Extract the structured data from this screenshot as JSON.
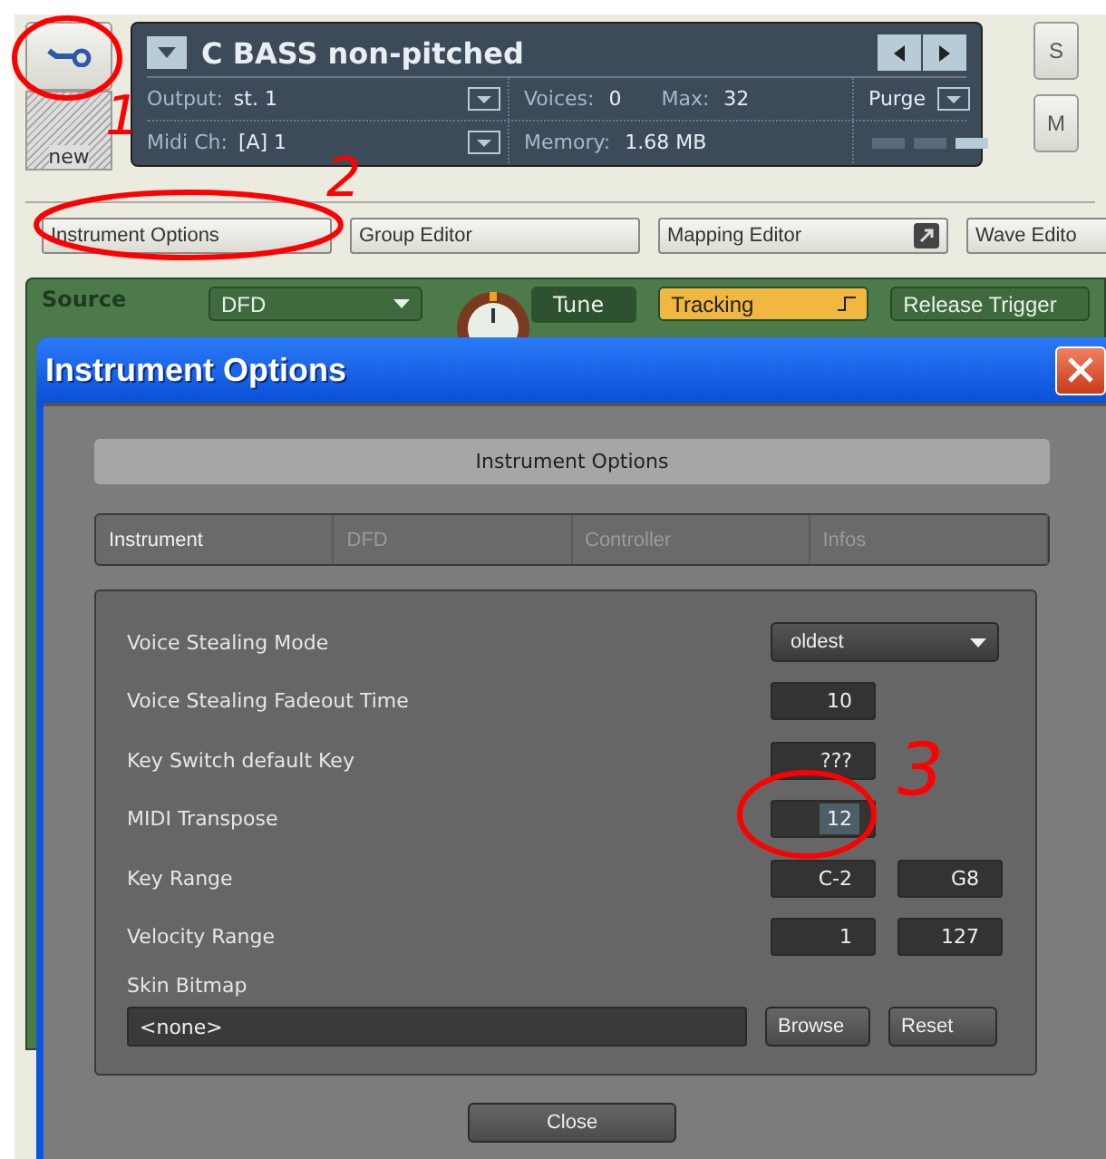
{
  "instrument_header": {
    "new_label": "new",
    "title": "C BASS non-pitched",
    "output_label": "Output:",
    "output_value": "st. 1",
    "midi_label": "Midi Ch:",
    "midi_value": "[A]  1",
    "voices_label": "Voices:",
    "voices_value": "0",
    "max_label": "Max:",
    "max_value": "32",
    "memory_label": "Memory:",
    "memory_value": "1.68 MB",
    "purge_label": "Purge"
  },
  "side_buttons": [
    "S",
    "M"
  ],
  "editor_tabs": [
    {
      "label": "Instrument Options",
      "kind": "plain"
    },
    {
      "label": "Group Editor",
      "kind": "plain"
    },
    {
      "label": "Mapping Editor",
      "kind": "popout"
    },
    {
      "label": "Wave Edito",
      "kind": "plain"
    }
  ],
  "source_bar": {
    "label": "Source",
    "mode": "DFD",
    "tune_label": "Tune",
    "switches": [
      {
        "label": "Tracking",
        "on": true
      },
      {
        "label": "Release Trigger",
        "on": false
      }
    ]
  },
  "dialog": {
    "title": "Instrument Options",
    "heading": "Instrument Options",
    "tabs": [
      {
        "label": "Instrument",
        "selected": true
      },
      {
        "label": "DFD",
        "selected": false
      },
      {
        "label": "Controller",
        "selected": false
      },
      {
        "label": "Infos",
        "selected": false
      }
    ],
    "settings": [
      {
        "kind": "dropdown",
        "label": "Voice Stealing Mode",
        "values": [
          "oldest"
        ],
        "text_selected": false
      },
      {
        "kind": "fields",
        "label": "Voice Stealing Fadeout Time",
        "values": [
          "10"
        ],
        "text_selected": false
      },
      {
        "kind": "fields",
        "label": "Key Switch default Key",
        "values": [
          "???"
        ],
        "text_selected": false
      },
      {
        "kind": "fields",
        "label": "MIDI Transpose",
        "values": [
          "12"
        ],
        "text_selected": true
      },
      {
        "kind": "fields",
        "label": "Key Range",
        "values": [
          "C-2",
          "G8"
        ],
        "text_selected": false
      },
      {
        "kind": "fields",
        "label": "Velocity Range",
        "values": [
          "1",
          "127"
        ],
        "text_selected": false
      }
    ],
    "skin": {
      "label": "Skin Bitmap",
      "value": "<none>",
      "buttons": [
        "Browse",
        "Reset"
      ]
    },
    "close_label": "Close"
  },
  "annotations": [
    {
      "number": "1"
    },
    {
      "number": "2"
    },
    {
      "number": "3"
    }
  ]
}
